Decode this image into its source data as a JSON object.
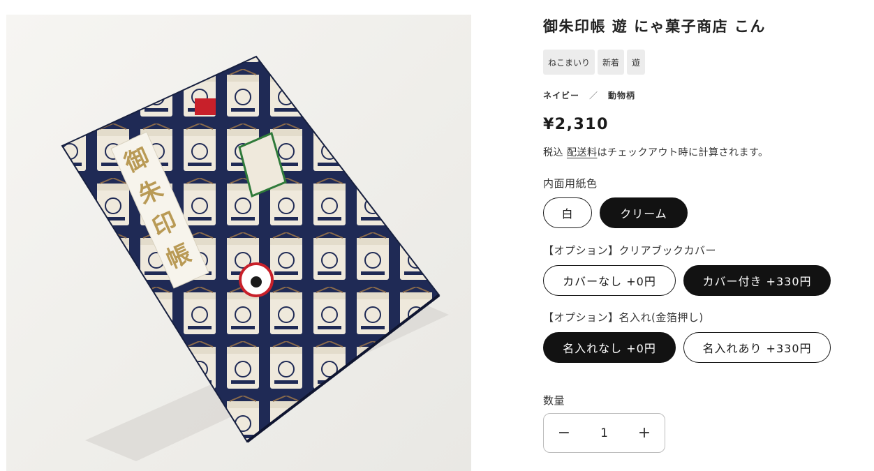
{
  "product": {
    "title": "御朱印帳 遊 にゃ菓子商店 こん",
    "image_alt": "御朱印帳 遊 にゃ菓子商店 こん",
    "tags": [
      "ねこまいり",
      "新着",
      "遊"
    ],
    "color": "ネイビー",
    "meta_separator": "／",
    "pattern": "動物柄",
    "price": "¥2,310",
    "tax_prefix": "税込 ",
    "shipping_link": "配送料",
    "tax_suffix": "はチェックアウト時に計算されます。"
  },
  "options": [
    {
      "label": "内面用紙色",
      "values": [
        "白",
        "クリーム"
      ],
      "selected": "クリーム"
    },
    {
      "label": "【オプション】クリアブックカバー",
      "values": [
        "カバーなし +0円",
        "カバー付き +330円"
      ],
      "selected": "カバー付き +330円"
    },
    {
      "label": "【オプション】名入れ(金箔押し)",
      "values": [
        "名入れなし +0円",
        "名入れあり +330円"
      ],
      "selected": "名入れなし +0円"
    }
  ],
  "quantity": {
    "label": "数量",
    "value": "1",
    "minus": "−",
    "plus": "+"
  },
  "book_cover": {
    "label_text": [
      "御",
      "朱",
      "印",
      "帳"
    ],
    "cover_color": "#1f2a55",
    "label_gold": "#b99a55"
  },
  "colors": {
    "selected_pill": "#121212",
    "tag_bg": "#ececec"
  }
}
